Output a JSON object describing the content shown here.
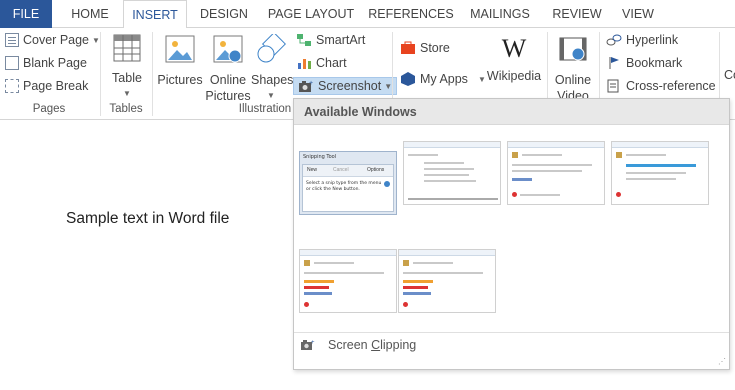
{
  "tabs": [
    "FILE",
    "HOME",
    "INSERT",
    "DESIGN",
    "PAGE LAYOUT",
    "REFERENCES",
    "MAILINGS",
    "REVIEW",
    "VIEW"
  ],
  "active_tab": "INSERT",
  "ribbon": {
    "pages": {
      "cover_page": "Cover Page",
      "blank_page": "Blank Page",
      "page_break": "Page Break",
      "label": "Pages"
    },
    "tables": {
      "table": "Table",
      "label": "Tables"
    },
    "illustrations": {
      "pictures": "Pictures",
      "online_pictures_1": "Online",
      "online_pictures_2": "Pictures",
      "shapes": "Shapes",
      "smartart": "SmartArt",
      "chart": "Chart",
      "screenshot": "Screenshot",
      "label": "Illustration"
    },
    "apps": {
      "store": "Store",
      "my_apps": "My Apps",
      "wikipedia": "Wikipedia"
    },
    "media": {
      "online_video_1": "Online",
      "online_video_2": "Video"
    },
    "links": {
      "hyperlink": "Hyperlink",
      "bookmark": "Bookmark",
      "cross_reference": "Cross-reference"
    },
    "cut_off_label": "Co"
  },
  "document": {
    "text": "Sample text in Word file"
  },
  "screenshot_panel": {
    "header": "Available Windows",
    "snipping_tool": {
      "title": "Snipping Tool",
      "new": "New",
      "cancel": "Cancel",
      "options": "Options",
      "hint": "Select a snip type from the menu or click the New button."
    },
    "screen_clipping_pre": "Screen ",
    "screen_clipping_underlined": "C",
    "screen_clipping_post": "lipping"
  },
  "colors": {
    "file_tab": "#2b579a",
    "accent": "#2b579a",
    "selected_button": "#c5dcf2"
  }
}
